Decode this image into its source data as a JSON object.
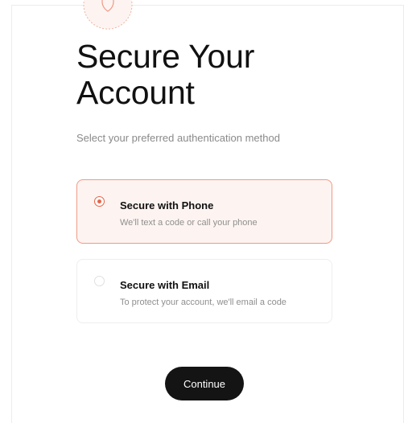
{
  "header": {
    "title_line1": "Secure Your",
    "title_line2": "Account",
    "subtitle": "Select your preferred authentication method"
  },
  "options": [
    {
      "title": "Secure with Phone",
      "description": "We'll text a code or call your phone",
      "selected": true
    },
    {
      "title": "Secure with Email",
      "description": "To protect your account, we'll email a code",
      "selected": false
    }
  ],
  "actions": {
    "continue_label": "Continue"
  },
  "icons": {
    "hero": "shield-icon"
  },
  "colors": {
    "accent": "#e8664a",
    "selected_border": "#ef9a86",
    "selected_bg": "#fdf4f1",
    "button_bg": "#141414"
  }
}
